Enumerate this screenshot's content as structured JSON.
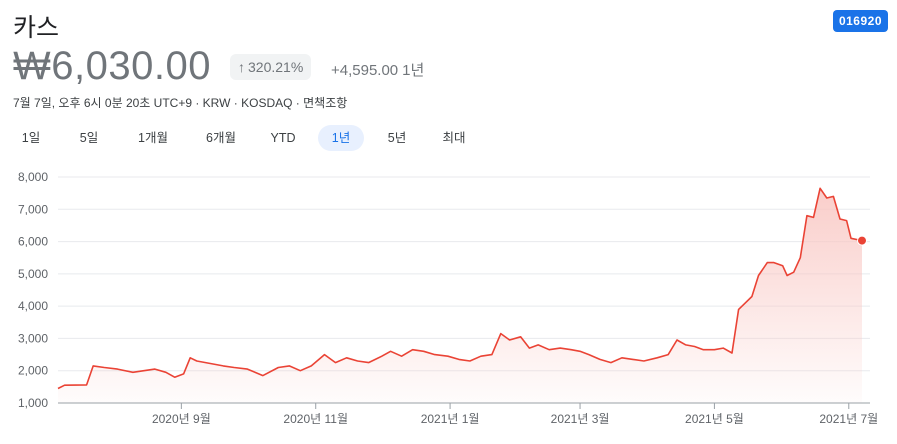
{
  "header": {
    "name": "카스",
    "ticker": "016920",
    "price": "₩6,030.00",
    "change_pct": "320.21%",
    "change_abs": "+4,595.00",
    "change_period": "1년",
    "meta": "7월 7일, 오후 6시 0분 20초 UTC+9 · KRW · KOSDAQ · 면책조항"
  },
  "tabs": [
    {
      "label": "1일",
      "active": false
    },
    {
      "label": "5일",
      "active": false
    },
    {
      "label": "1개월",
      "active": false
    },
    {
      "label": "6개월",
      "active": false
    },
    {
      "label": "YTD",
      "active": false
    },
    {
      "label": "1년",
      "active": true
    },
    {
      "label": "5년",
      "active": false
    },
    {
      "label": "최대",
      "active": false
    }
  ],
  "colors": {
    "line": "#ea4335",
    "fill_top": "#f9c8c4",
    "grid": "#e8eaed",
    "accent": "#1a73e8"
  },
  "chart_data": {
    "type": "area",
    "title": "",
    "xlabel": "",
    "ylabel": "",
    "ylim": [
      1000,
      8000
    ],
    "y_ticks": [
      "1,000",
      "2,000",
      "3,000",
      "4,000",
      "5,000",
      "6,000",
      "7,000",
      "8,000"
    ],
    "x_ticks": [
      "2020년 9월",
      "2020년 11월",
      "2021년 1월",
      "2021년 3월",
      "2021년 5월",
      "2021년 7월"
    ],
    "grid": true,
    "last_point_marker": true,
    "series": [
      {
        "points": [
          [
            "2020-07-07",
            1450
          ],
          [
            "2020-07-10",
            1550
          ],
          [
            "2020-07-20",
            1560
          ],
          [
            "2020-07-23",
            2150
          ],
          [
            "2020-07-28",
            2100
          ],
          [
            "2020-08-03",
            2050
          ],
          [
            "2020-08-10",
            1950
          ],
          [
            "2020-08-15",
            2000
          ],
          [
            "2020-08-20",
            2050
          ],
          [
            "2020-08-25",
            1950
          ],
          [
            "2020-08-29",
            1800
          ],
          [
            "2020-09-02",
            1900
          ],
          [
            "2020-09-05",
            2400
          ],
          [
            "2020-09-08",
            2300
          ],
          [
            "2020-09-12",
            2250
          ],
          [
            "2020-09-20",
            2150
          ],
          [
            "2020-09-25",
            2100
          ],
          [
            "2020-10-01",
            2050
          ],
          [
            "2020-10-08",
            1850
          ],
          [
            "2020-10-15",
            2100
          ],
          [
            "2020-10-20",
            2150
          ],
          [
            "2020-10-25",
            2000
          ],
          [
            "2020-10-30",
            2150
          ],
          [
            "2020-11-05",
            2500
          ],
          [
            "2020-11-10",
            2250
          ],
          [
            "2020-11-15",
            2400
          ],
          [
            "2020-11-20",
            2300
          ],
          [
            "2020-11-25",
            2250
          ],
          [
            "2020-12-01",
            2450
          ],
          [
            "2020-12-05",
            2600
          ],
          [
            "2020-12-10",
            2450
          ],
          [
            "2020-12-15",
            2650
          ],
          [
            "2020-12-20",
            2600
          ],
          [
            "2020-12-25",
            2500
          ],
          [
            "2020-12-31",
            2450
          ],
          [
            "2021-01-05",
            2350
          ],
          [
            "2021-01-10",
            2300
          ],
          [
            "2021-01-15",
            2450
          ],
          [
            "2021-01-20",
            2500
          ],
          [
            "2021-01-24",
            3150
          ],
          [
            "2021-01-28",
            2950
          ],
          [
            "2021-02-02",
            3050
          ],
          [
            "2021-02-06",
            2700
          ],
          [
            "2021-02-10",
            2800
          ],
          [
            "2021-02-15",
            2650
          ],
          [
            "2021-02-20",
            2700
          ],
          [
            "2021-02-25",
            2650
          ],
          [
            "2021-03-01",
            2600
          ],
          [
            "2021-03-05",
            2500
          ],
          [
            "2021-03-10",
            2350
          ],
          [
            "2021-03-15",
            2250
          ],
          [
            "2021-03-20",
            2400
          ],
          [
            "2021-03-25",
            2350
          ],
          [
            "2021-03-30",
            2300
          ],
          [
            "2021-04-05",
            2400
          ],
          [
            "2021-04-10",
            2500
          ],
          [
            "2021-04-14",
            2950
          ],
          [
            "2021-04-18",
            2800
          ],
          [
            "2021-04-22",
            2750
          ],
          [
            "2021-04-26",
            2650
          ],
          [
            "2021-05-01",
            2650
          ],
          [
            "2021-05-05",
            2700
          ],
          [
            "2021-05-09",
            2550
          ],
          [
            "2021-05-12",
            3900
          ],
          [
            "2021-05-15",
            4100
          ],
          [
            "2021-05-18",
            4300
          ],
          [
            "2021-05-21",
            4950
          ],
          [
            "2021-05-25",
            5350
          ],
          [
            "2021-05-28",
            5350
          ],
          [
            "2021-06-01",
            5250
          ],
          [
            "2021-06-03",
            4950
          ],
          [
            "2021-06-06",
            5050
          ],
          [
            "2021-06-09",
            5500
          ],
          [
            "2021-06-12",
            6800
          ],
          [
            "2021-06-15",
            6750
          ],
          [
            "2021-06-18",
            7650
          ],
          [
            "2021-06-21",
            7350
          ],
          [
            "2021-06-24",
            7400
          ],
          [
            "2021-06-27",
            6700
          ],
          [
            "2021-06-30",
            6650
          ],
          [
            "2021-07-02",
            6100
          ],
          [
            "2021-07-07",
            6030
          ]
        ]
      }
    ]
  }
}
